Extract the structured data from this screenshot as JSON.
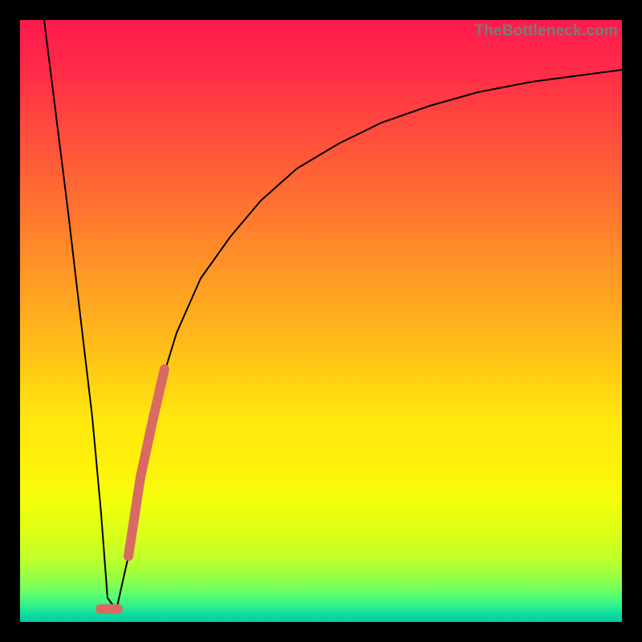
{
  "watermark": "TheBottleneck.com",
  "colors": {
    "frame": "#000000",
    "curve": "#000000",
    "highlight": "#d86a63",
    "gradient_top": "#ff1a4d",
    "gradient_mid": "#ffe60f",
    "gradient_bottom": "#07c9a6"
  },
  "chart_data": {
    "type": "line",
    "title": "",
    "xlabel": "",
    "ylabel": "",
    "xlim": [
      0,
      100
    ],
    "ylim": [
      0,
      100
    ],
    "grid": false,
    "legend": false,
    "series": [
      {
        "name": "bottleneck-curve",
        "x": [
          4,
          6,
          8,
          10,
          12,
          13.5,
          14.5,
          16,
          18,
          20,
          23,
          26,
          30,
          35,
          40,
          46,
          53,
          60,
          68,
          76,
          85,
          95,
          100
        ],
        "values": [
          100,
          84,
          68,
          51,
          34,
          18,
          4,
          2,
          11,
          24,
          38,
          48,
          57,
          64,
          70,
          75,
          79.5,
          83,
          85.8,
          88,
          89.8,
          91,
          91.8
        ]
      },
      {
        "name": "highlight-segment",
        "x": [
          14.5,
          16,
          18,
          20,
          22,
          24
        ],
        "values": [
          3,
          2.5,
          11,
          24,
          33,
          42
        ]
      }
    ],
    "annotations": [
      {
        "type": "point",
        "name": "highlight-min",
        "x": 15.5,
        "y": 2.2
      }
    ]
  }
}
